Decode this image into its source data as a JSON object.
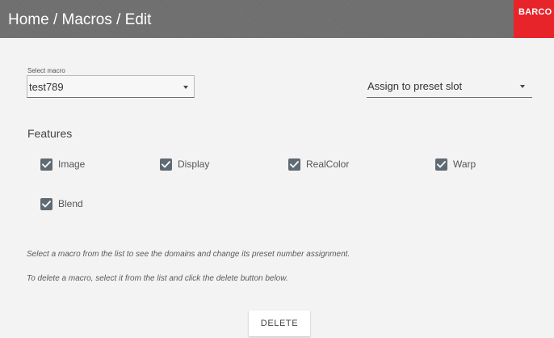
{
  "header": {
    "breadcrumb": "Home / Macros / Edit",
    "brand": "BARCO",
    "background_color": "#6f6f6f",
    "brand_color": "#e8242b"
  },
  "macro_select": {
    "label": "Select macro",
    "value": "test789",
    "icon": "caret-down-icon"
  },
  "preset_select": {
    "value": "Assign to preset slot",
    "icon": "caret-down-icon"
  },
  "features": {
    "heading": "Features",
    "items": [
      {
        "label": "Image",
        "checked": true
      },
      {
        "label": "Display",
        "checked": true
      },
      {
        "label": "RealColor",
        "checked": true
      },
      {
        "label": "Warp",
        "checked": true
      },
      {
        "label": "Blend",
        "checked": true
      }
    ],
    "checkbox_color": "#5f6a73"
  },
  "info": {
    "line1": "Select a macro from the list to see the domains and change its preset number assignment.",
    "line2": "To delete a macro, select it from the list and click the delete button below."
  },
  "actions": {
    "delete_label": "DELETE"
  }
}
